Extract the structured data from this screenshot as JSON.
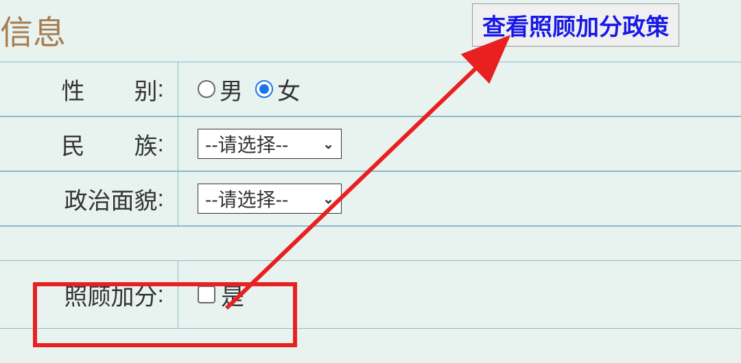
{
  "section_title": "信息",
  "policy_button_label": "查看照顾加分政策",
  "fields": {
    "gender": {
      "label_char1": "性",
      "label_char2": "别",
      "colon": ":",
      "option_male": "男",
      "option_female": "女",
      "selected": "female"
    },
    "ethnicity": {
      "label_char1": "民",
      "label_char2": "族",
      "colon": ":",
      "placeholder": "--请选择--"
    },
    "political": {
      "label": "政治面貌",
      "colon": ":",
      "placeholder": "--请选择--"
    },
    "bonus": {
      "label": "照顾加分",
      "colon": ":",
      "option_yes": "是"
    }
  }
}
